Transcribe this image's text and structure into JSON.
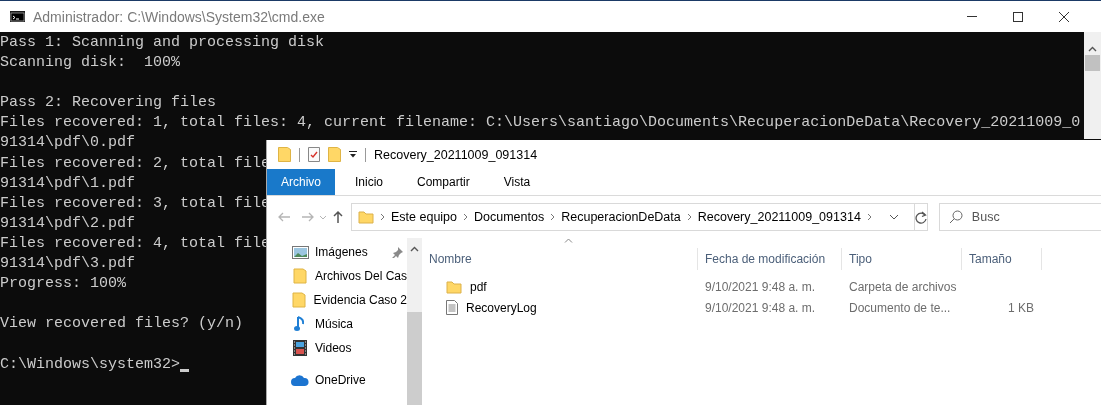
{
  "cmd": {
    "title": "Administrador: C:\\Windows\\System32\\cmd.exe",
    "blocks": [
      [
        "Pass 1: Scanning and processing disk",
        "Scanning disk:  100%"
      ],
      [
        "Pass 2: Recovering files",
        "Files recovered: 1, total files: 4, current filename: C:\\Users\\santiago\\Documents\\RecuperacionDeData\\Recovery_20211009_0",
        "91314\\pdf\\0.pdf",
        "Files recovered: 2, total file",
        "91314\\pdf\\1.pdf",
        "Files recovered: 3, total file",
        "91314\\pdf\\2.pdf",
        "Files recovered: 4, total file",
        "91314\\pdf\\3.pdf",
        "Progress: 100%"
      ],
      [
        "View recovered files? (y/n)"
      ]
    ],
    "prompt": "C:\\Windows\\system32>"
  },
  "explorer": {
    "title": "Recovery_20211009_091314",
    "ribbon_tabs": [
      {
        "label": "Archivo",
        "selected": true
      },
      {
        "label": "Inicio",
        "selected": false
      },
      {
        "label": "Compartir",
        "selected": false
      },
      {
        "label": "Vista",
        "selected": false
      }
    ],
    "breadcrumbs": [
      "Este equipo",
      "Documentos",
      "RecuperacionDeData",
      "Recovery_20211009_091314"
    ],
    "search": {
      "placeholder": "Busc"
    },
    "nav_groups": [
      [
        {
          "kind": "images",
          "label": "Imágenes",
          "pinned": true
        },
        {
          "kind": "folder",
          "label": "Archivos Del Cas",
          "pinned": false
        },
        {
          "kind": "folder",
          "label": "Evidencia Caso 2",
          "pinned": false
        },
        {
          "kind": "music",
          "label": "Música",
          "pinned": false
        },
        {
          "kind": "videos",
          "label": "Videos",
          "pinned": false
        }
      ],
      [
        {
          "kind": "cloud",
          "label": "OneDrive",
          "pinned": false
        }
      ]
    ],
    "columns": [
      {
        "label": "Nombre",
        "sorted": true
      },
      {
        "label": "Fecha de modificación",
        "sorted": false
      },
      {
        "label": "Tipo",
        "sorted": false
      },
      {
        "label": "Tamaño",
        "sorted": false
      }
    ],
    "files": [
      {
        "kind": "folder",
        "name": "pdf",
        "modified": "9/10/2021 9:48 a. m.",
        "type": "Carpeta de archivos"
      },
      {
        "kind": "text",
        "name": "RecoveryLog",
        "modified": "9/10/2021 9:48 a. m.",
        "type": "Documento de te...",
        "size": "1 KB"
      }
    ]
  }
}
